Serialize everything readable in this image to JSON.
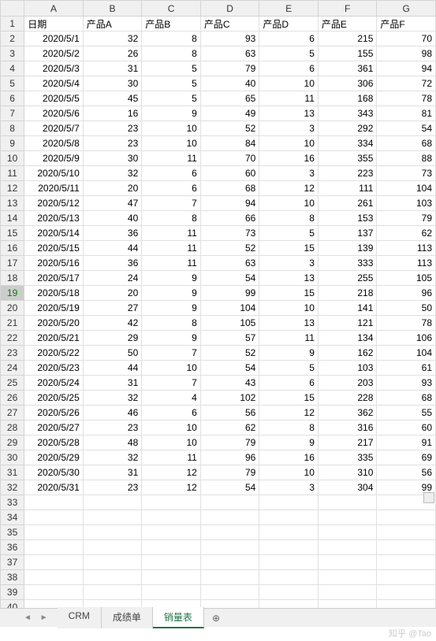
{
  "columns": [
    "A",
    "B",
    "C",
    "D",
    "E",
    "F",
    "G"
  ],
  "header_row": [
    "日期",
    "产品A",
    "产品B",
    "产品C",
    "产品D",
    "产品E",
    "产品F"
  ],
  "selected_row_header": 19,
  "total_rows": 40,
  "tabs": {
    "items": [
      "CRM",
      "成绩单",
      "销量表"
    ],
    "active": "销量表"
  },
  "watermark": "知乎 @Tao",
  "chart_data": {
    "type": "table",
    "title": "销量表",
    "columns": [
      "日期",
      "产品A",
      "产品B",
      "产品C",
      "产品D",
      "产品E",
      "产品F"
    ],
    "rows": [
      [
        "2020/5/1",
        32,
        8,
        93,
        6,
        215,
        70
      ],
      [
        "2020/5/2",
        26,
        8,
        63,
        5,
        155,
        98
      ],
      [
        "2020/5/3",
        31,
        5,
        79,
        6,
        361,
        94
      ],
      [
        "2020/5/4",
        30,
        5,
        40,
        10,
        306,
        72
      ],
      [
        "2020/5/5",
        45,
        5,
        65,
        11,
        168,
        78
      ],
      [
        "2020/5/6",
        16,
        9,
        49,
        13,
        343,
        81
      ],
      [
        "2020/5/7",
        23,
        10,
        52,
        3,
        292,
        54
      ],
      [
        "2020/5/8",
        23,
        10,
        84,
        10,
        334,
        68
      ],
      [
        "2020/5/9",
        30,
        11,
        70,
        16,
        355,
        88
      ],
      [
        "2020/5/10",
        32,
        6,
        60,
        3,
        223,
        73
      ],
      [
        "2020/5/11",
        20,
        6,
        68,
        12,
        111,
        104
      ],
      [
        "2020/5/12",
        47,
        7,
        94,
        10,
        261,
        103
      ],
      [
        "2020/5/13",
        40,
        8,
        66,
        8,
        153,
        79
      ],
      [
        "2020/5/14",
        36,
        11,
        73,
        5,
        137,
        62
      ],
      [
        "2020/5/15",
        44,
        11,
        52,
        15,
        139,
        113
      ],
      [
        "2020/5/16",
        36,
        11,
        63,
        3,
        333,
        113
      ],
      [
        "2020/5/17",
        24,
        9,
        54,
        13,
        255,
        105
      ],
      [
        "2020/5/18",
        20,
        9,
        99,
        15,
        218,
        96
      ],
      [
        "2020/5/19",
        27,
        9,
        104,
        10,
        141,
        50
      ],
      [
        "2020/5/20",
        42,
        8,
        105,
        13,
        121,
        78
      ],
      [
        "2020/5/21",
        29,
        9,
        57,
        11,
        134,
        106
      ],
      [
        "2020/5/22",
        50,
        7,
        52,
        9,
        162,
        104
      ],
      [
        "2020/5/23",
        44,
        10,
        54,
        5,
        103,
        61
      ],
      [
        "2020/5/24",
        31,
        7,
        43,
        6,
        203,
        93
      ],
      [
        "2020/5/25",
        32,
        4,
        102,
        15,
        228,
        68
      ],
      [
        "2020/5/26",
        46,
        6,
        56,
        12,
        362,
        55
      ],
      [
        "2020/5/27",
        23,
        10,
        62,
        8,
        316,
        60
      ],
      [
        "2020/5/28",
        48,
        10,
        79,
        9,
        217,
        91
      ],
      [
        "2020/5/29",
        32,
        11,
        96,
        16,
        335,
        69
      ],
      [
        "2020/5/30",
        31,
        12,
        79,
        10,
        310,
        56
      ],
      [
        "2020/5/31",
        23,
        12,
        54,
        3,
        304,
        99
      ]
    ]
  }
}
